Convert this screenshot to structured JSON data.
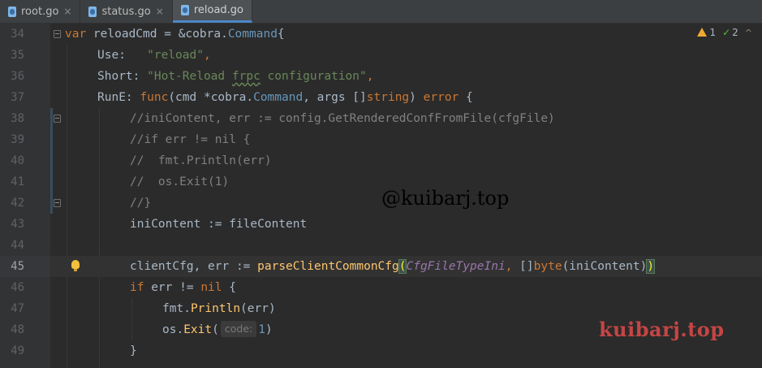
{
  "tabs": [
    {
      "name": "root.go",
      "active": false
    },
    {
      "name": "status.go",
      "active": false
    },
    {
      "name": "reload.go",
      "active": true
    }
  ],
  "tab_close_glyph": "×",
  "inspections": {
    "warnings": "1",
    "weak_warnings": "2",
    "chevron": "^"
  },
  "hint": {
    "label": "code:"
  },
  "lines": {
    "34": {
      "number": "34",
      "t": [
        "var",
        " reloadCmd = &",
        "cobra",
        ".",
        "Command",
        "{"
      ]
    },
    "35": {
      "number": "35",
      "t": [
        "Use:   ",
        "\"reload\"",
        ","
      ]
    },
    "36": {
      "number": "36",
      "t": [
        "Short: ",
        "\"Hot-Reload ",
        "frpc",
        " configuration\"",
        ","
      ]
    },
    "37": {
      "number": "37",
      "t": [
        "RunE: ",
        "func",
        "(cmd *",
        "cobra",
        ".",
        "Command",
        ", args []",
        "string",
        ") ",
        "error",
        " {"
      ]
    },
    "38": {
      "number": "38",
      "t": [
        "//iniContent, err := config.GetRenderedConfFromFile(cfgFile)"
      ]
    },
    "39": {
      "number": "39",
      "t": [
        "//if err != nil {"
      ]
    },
    "40": {
      "number": "40",
      "t": [
        "//  fmt.Println(err)"
      ]
    },
    "41": {
      "number": "41",
      "t": [
        "//  os.Exit(1)"
      ]
    },
    "42": {
      "number": "42",
      "t": [
        "//}"
      ]
    },
    "43": {
      "number": "43",
      "t": [
        "iniContent := fileContent"
      ]
    },
    "44": {
      "number": "44",
      "t": []
    },
    "45": {
      "number": "45",
      "t": [
        "clientCfg, err := ",
        "parseClientCommonCfg",
        "(",
        "CfgFileTypeIni",
        ", []",
        "byte",
        "(iniContent)",
        ")"
      ]
    },
    "46": {
      "number": "46",
      "t": [
        "if",
        " err != ",
        "nil",
        " {"
      ]
    },
    "47": {
      "number": "47",
      "t": [
        "fmt",
        ".",
        "Println",
        "(err)"
      ]
    },
    "48": {
      "number": "48",
      "t": [
        "os",
        ".",
        "Exit",
        "(",
        "1",
        ")"
      ]
    },
    "49": {
      "number": "49",
      "t": [
        "}"
      ]
    }
  },
  "watermarks": {
    "handle": "@kuibarj.top",
    "logo": "kuibarj.top"
  },
  "colors": {
    "background": "#2b2b2b",
    "gutter": "#313335",
    "keyword": "#cc7832",
    "string": "#6a8759",
    "function": "#ffc66d",
    "type": "#6897bb",
    "comment": "#808080",
    "param": "#9876aa",
    "accent_tab": "#4a88c7",
    "logo_red": "#c54545"
  },
  "icons": {
    "file": "go-file-icon",
    "warning": "warning-icon",
    "weak_warning": "check-icon",
    "intention": "bulb-icon",
    "fold": "fold-marker"
  }
}
